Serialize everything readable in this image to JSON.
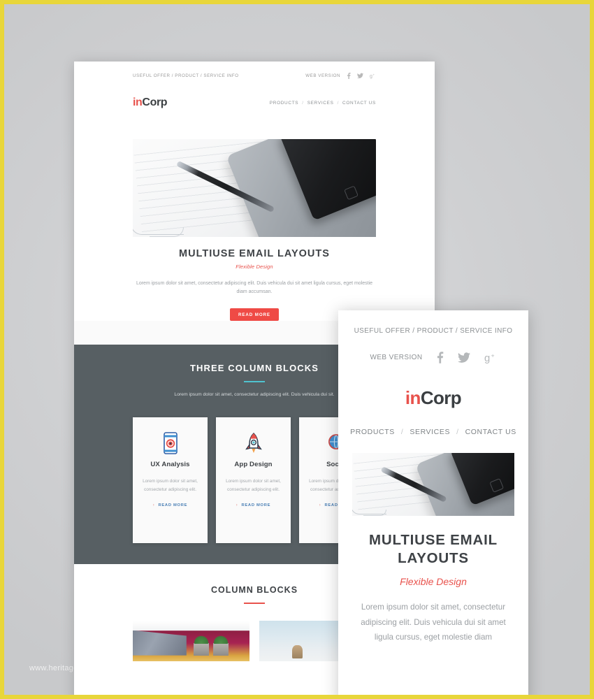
{
  "watermark": "www.heritagechristiancollege.com",
  "brand": {
    "accent_red": "#e8524c",
    "dark_section": "#575f63",
    "divider_teal": "#4fc3d0",
    "link_blue": "#4a7fb5",
    "border_yellow": "#e8d63a",
    "logo_prefix": "in",
    "logo_suffix": "Corp"
  },
  "desktop": {
    "preheader": "USEFUL OFFER / PRODUCT / SERVICE INFO",
    "web_version": "WEB VERSION",
    "social": [
      {
        "name": "facebook-icon",
        "label": "f"
      },
      {
        "name": "twitter-icon",
        "label": "t"
      },
      {
        "name": "google-plus-icon",
        "label": "g+"
      }
    ],
    "nav": [
      {
        "label": "PRODUCTS"
      },
      {
        "label": "SERVICES"
      },
      {
        "label": "CONTACT US"
      }
    ],
    "nav_separator": "/",
    "hero": {
      "image_alt": "notepad-pen-tablet-phone-photo",
      "title": "MULTIUSE EMAIL LAYOUTS",
      "subtitle": "Flexible Design",
      "body": "Lorem ipsum dolor sit amet, consectetur adipiscing elit. Duis vehicula dui sit amet ligula cursus, eget molestie diam accumsan.",
      "cta": "READ MORE"
    },
    "three_column": {
      "title": "THREE COLUMN BLOCKS",
      "body": "Lorem ipsum dolor sit amet, consectetur adipiscing elit. Duis vehicula dui sit.",
      "cards": [
        {
          "icon": "mobile-target-icon",
          "title": "UX Analysis",
          "text": "Lorem ipsum dolor sit amet, consectetur adipiscing elit.",
          "link": "READ MORE"
        },
        {
          "icon": "rocket-icon",
          "title": "App Design",
          "text": "Lorem ipsum dolor sit amet, consectetur adipiscing elit.",
          "link": "READ MORE"
        },
        {
          "icon": "social-globe-icon",
          "title": "Social",
          "text": "Lorem ipsum dolor sit amet, consectetur adipiscing elit.",
          "link": "READ MORE"
        }
      ]
    },
    "column_blocks": {
      "title": "COLUMN BLOCKS",
      "blocks": [
        {
          "image_alt": "magenta-wall-with-planters-photo"
        },
        {
          "image_alt": "pale-blue-sky-landscape-photo"
        }
      ]
    }
  },
  "mobile": {
    "preheader": "USEFUL OFFER / PRODUCT / SERVICE INFO",
    "web_version": "WEB VERSION",
    "social": [
      {
        "name": "facebook-icon",
        "label": "f"
      },
      {
        "name": "twitter-icon",
        "label": "t"
      },
      {
        "name": "google-plus-icon",
        "label": "g+"
      }
    ],
    "nav": [
      {
        "label": "PRODUCTS"
      },
      {
        "label": "SERVICES"
      },
      {
        "label": "CONTACT US"
      }
    ],
    "nav_separator": "/",
    "hero": {
      "image_alt": "notepad-pen-tablet-phone-photo",
      "title": "MULTIUSE EMAIL LAYOUTS",
      "subtitle": "Flexible Design",
      "body": "Lorem ipsum dolor sit amet, consectetur adipiscing elit. Duis vehicula dui sit amet ligula cursus, eget molestie diam"
    }
  }
}
